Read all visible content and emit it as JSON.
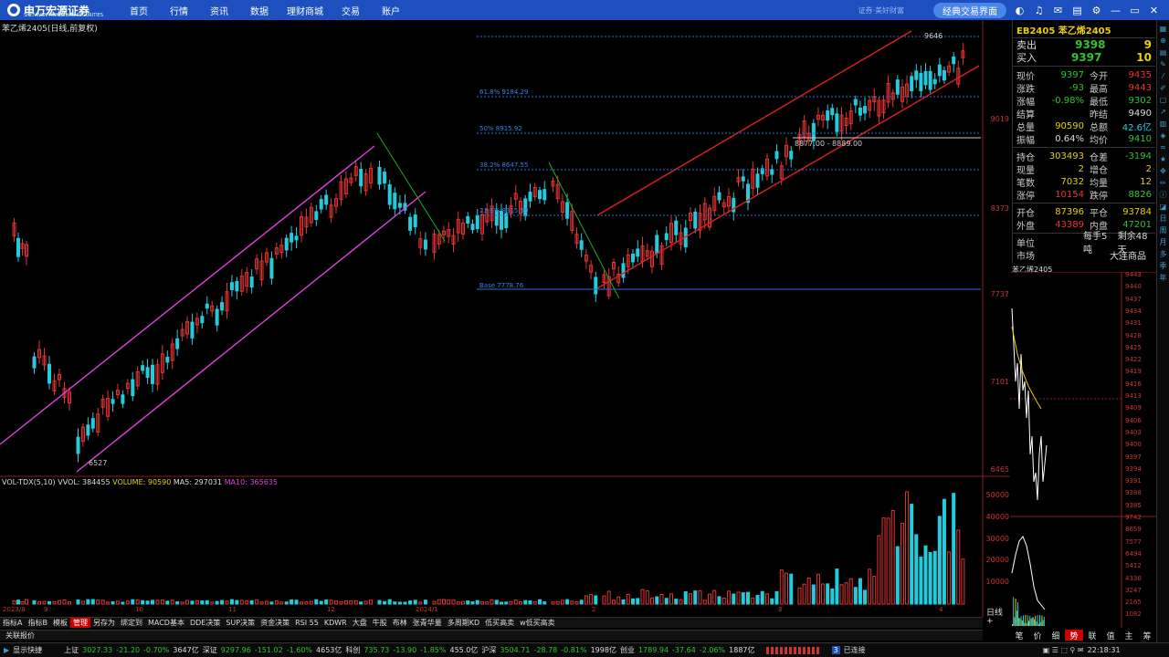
{
  "topbar": {
    "brand": "申万宏源证券",
    "brand_sub": "SHENWAN HONGYUAN SECURITIES",
    "nav": [
      "首页",
      "行情",
      "资讯",
      "数据",
      "理财商城",
      "交易",
      "账户"
    ],
    "slogan": "证券·美好财富",
    "classic_btn": "经典交易界面"
  },
  "chart_title": "苯乙烯2405(日线,前复权)",
  "price_ticks": [
    "9019",
    "8373",
    "7737",
    "7101",
    "6465"
  ],
  "annotations": {
    "high": "9646",
    "low": "6527",
    "fib618": "61.8% 9184.29",
    "fib50": "50% 8915.92",
    "fib382": "38.2% 8647.55",
    "fib236": "23.6% 8315.59",
    "base": "Base 7778.76",
    "range": "8877.00 - 8889.00"
  },
  "vol_ticks": [
    "50000",
    "40000",
    "30000",
    "20000",
    "10000"
  ],
  "vol_legend": {
    "name": "VOL-TDX(5,10)",
    "vvol": "VVOL: 384455",
    "volume": "VOLUME: 90590",
    "ma5": "MA5: 297031",
    "ma10": "MA10: 365635"
  },
  "date_labels": [
    "2023/8",
    "9",
    "10",
    "11",
    "12",
    "2024/1",
    "2",
    "3",
    "4"
  ],
  "bottom_tabs": [
    "指标A",
    "指标B",
    "模板",
    "管理",
    "另存为",
    "绑定到",
    "MACD基本",
    "DDE决策",
    "SUP决策",
    "资金决策",
    "RSI 55",
    "KDWR",
    "大盘",
    "牛股",
    "布林",
    "张青华量",
    "多周期KD",
    "低买高卖",
    "w低买高卖"
  ],
  "active_tab": "管理",
  "linked": "关联报价",
  "day_tag": "日线",
  "pm": "+ -",
  "quote": {
    "head": "EB2405 苯乙烯2405",
    "sell": {
      "label": "卖出",
      "price": "9398",
      "qty": "9"
    },
    "buy": {
      "label": "买入",
      "price": "9397",
      "qty": "10"
    },
    "rows": [
      {
        "l": "现价",
        "v": "9397",
        "vc": "dn",
        "l2": "今开",
        "v2": "9435",
        "v2c": "up"
      },
      {
        "l": "涨跌",
        "v": "-93",
        "vc": "dn",
        "l2": "最高",
        "v2": "9443",
        "v2c": "up"
      },
      {
        "l": "涨幅",
        "v": "-0.98%",
        "vc": "dn",
        "l2": "最低",
        "v2": "9302",
        "v2c": "dn"
      },
      {
        "l": "结算",
        "v": "",
        "vc": "wh",
        "l2": "昨结",
        "v2": "9490",
        "v2c": "wh"
      },
      {
        "l": "总量",
        "v": "90590",
        "vc": "yl",
        "l2": "总额",
        "v2": "42.6亿",
        "v2c": "cy"
      },
      {
        "l": "振幅",
        "v": "0.64%",
        "vc": "wh",
        "l2": "均价",
        "v2": "9410",
        "v2c": "dn"
      }
    ],
    "rows2": [
      {
        "l": "持仓",
        "v": "303493",
        "vc": "yl",
        "l2": "仓差",
        "v2": "-3194",
        "v2c": "dn"
      },
      {
        "l": "现量",
        "v": "2",
        "vc": "yl",
        "l2": "增仓",
        "v2": "2",
        "v2c": "yl"
      },
      {
        "l": "笔数",
        "v": "7032",
        "vc": "yl",
        "l2": "均量",
        "v2": "12",
        "v2c": "yl"
      },
      {
        "l": "涨停",
        "v": "10154",
        "vc": "up",
        "l2": "跌停",
        "v2": "8826",
        "v2c": "dn"
      }
    ],
    "rows3": [
      {
        "l": "开仓",
        "v": "87396",
        "vc": "yl",
        "l2": "平仓",
        "v2": "93784",
        "v2c": "yl"
      },
      {
        "l": "外盘",
        "v": "43389",
        "vc": "up",
        "l2": "内盘",
        "v2": "47201",
        "v2c": "dn"
      }
    ],
    "unit": {
      "l": "单位",
      "v": "每手5吨",
      "r": "剩余48天"
    },
    "market": {
      "l": "市场",
      "v": "大连商品"
    }
  },
  "mini_title": "苯乙烯2405",
  "mini_ticks": [
    "9443",
    "9440",
    "9437",
    "9434",
    "9431",
    "9428",
    "9425",
    "9422",
    "9419",
    "9416",
    "9413",
    "9409",
    "9406",
    "9403",
    "9400",
    "9397",
    "9394",
    "9391",
    "9388",
    "9385",
    "9742",
    "8659",
    "7577",
    "6494",
    "5412",
    "4330",
    "3247",
    "2165",
    "1082"
  ],
  "right_tabs": [
    "笔",
    "价",
    "细",
    "势",
    "联",
    "值",
    "主",
    "筹"
  ],
  "right_active": "势",
  "toolbar_icons": [
    "grid-icon",
    "pin-icon",
    "chart-icon",
    "draw-icon",
    "line-icon",
    "pen-icon",
    "box-icon",
    "trend-icon",
    "bars-icon",
    "chip-icon",
    "rsi-icon",
    "star-icon",
    "move-icon",
    "pencil-icon",
    "info-icon",
    "brush-icon"
  ],
  "toolbar_text": [
    "日",
    "周",
    "月",
    "多",
    "季",
    "年"
  ],
  "statusbar": {
    "quick": "显示快捷",
    "idx": [
      {
        "name": "上证",
        "v": "3027.33",
        "c": "-21.20",
        "p": "-0.70%",
        "a": "3647亿"
      },
      {
        "name": "深证",
        "v": "9297.96",
        "c": "-151.02",
        "p": "-1.60%",
        "a": "4653亿"
      },
      {
        "name": "科创",
        "v": "735.73",
        "c": "-13.90",
        "p": "-1.85%",
        "a": "455.0亿"
      },
      {
        "name": "沪深",
        "v": "3504.71",
        "c": "-28.78",
        "p": "-0.81%",
        "a": "1998亿"
      },
      {
        "name": "创业",
        "v": "1789.94",
        "c": "-37.64",
        "p": "-2.06%",
        "a": "1887亿"
      }
    ],
    "conn": "已连接",
    "conn_num": "3",
    "time": "22:18:31"
  },
  "colors": {
    "up": "#e33333",
    "down": "#22ccdd",
    "channel_left": "#e040e0",
    "channel_right": "#e02020",
    "bar": "#1d4fbf"
  }
}
